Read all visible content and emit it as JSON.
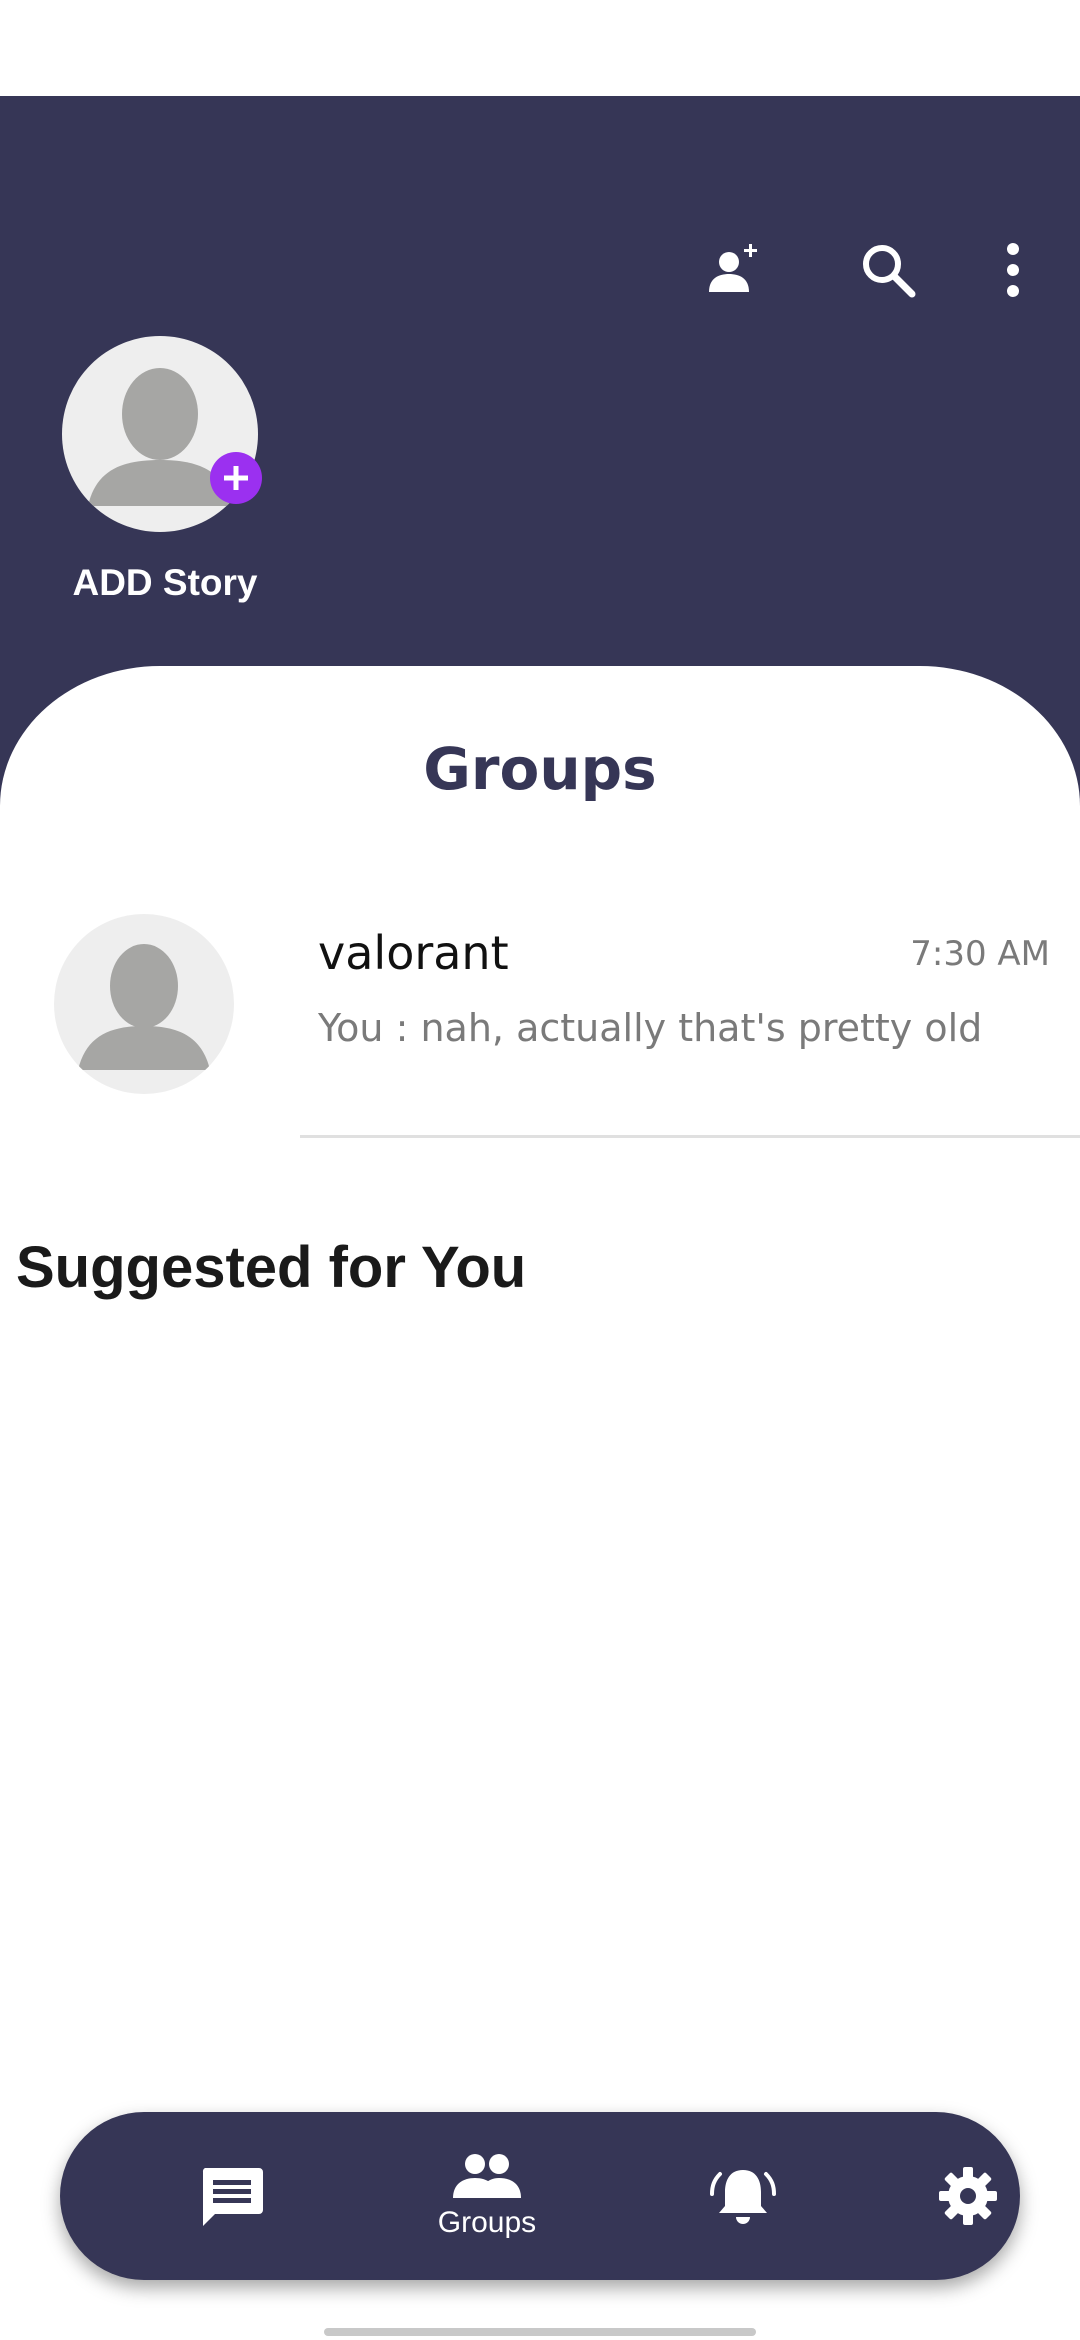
{
  "header": {
    "add_friend_icon": "add-person-icon",
    "search_icon": "search-icon",
    "more_icon": "more-vert-icon",
    "background_color": "#363656"
  },
  "story": {
    "label": "ADD Story",
    "avatar_icon": "person-silhouette",
    "add_badge_icon": "plus-icon",
    "badge_color": "#9b30f0"
  },
  "main": {
    "title": "Groups",
    "chats": [
      {
        "name": "valorant",
        "time": "7:30 AM",
        "preview": "You : nah, actually that's pretty old"
      }
    ],
    "suggested_title": "Suggested for You"
  },
  "bottom_nav": {
    "items": [
      {
        "icon": "chat-icon",
        "label": ""
      },
      {
        "icon": "groups-icon",
        "label": "Groups",
        "active": true
      },
      {
        "icon": "notifications-icon",
        "label": ""
      },
      {
        "icon": "settings-icon",
        "label": ""
      }
    ]
  }
}
